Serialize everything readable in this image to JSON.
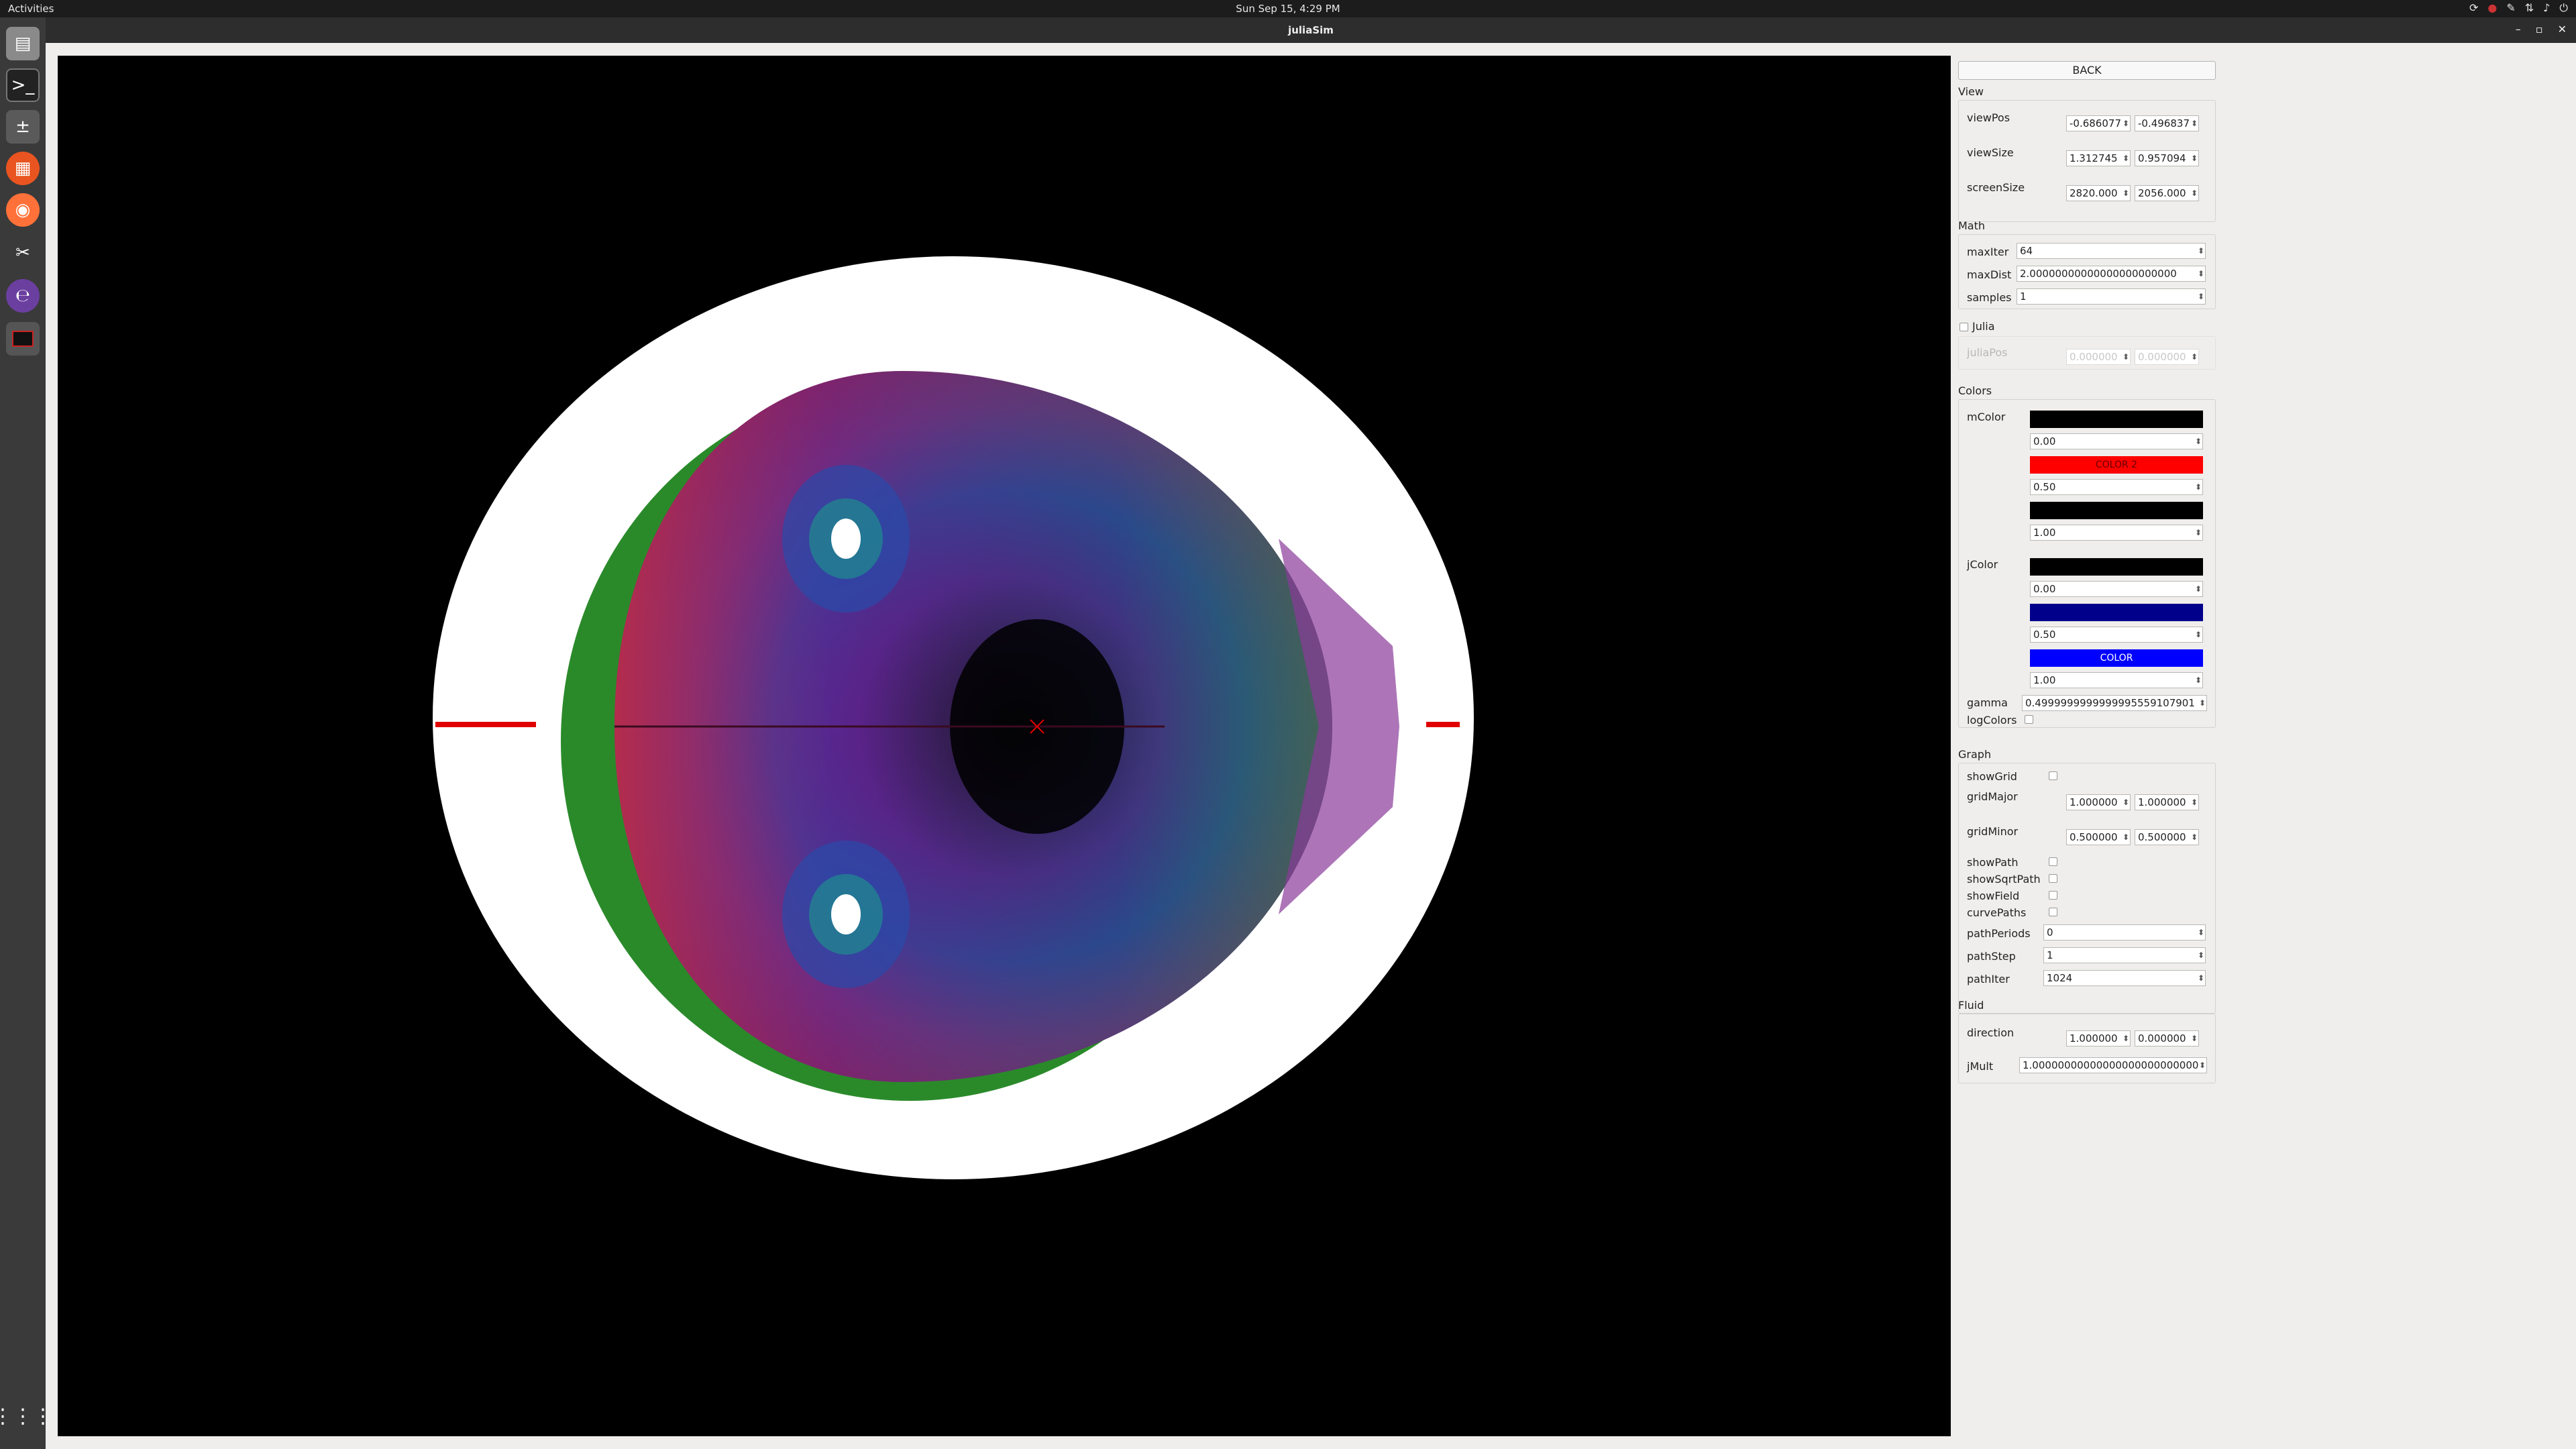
{
  "topbar": {
    "activities": "Activities",
    "clock": "Sun Sep 15,  4:29 PM"
  },
  "window": {
    "title": "juliaSim"
  },
  "panel": {
    "back_label": "BACK",
    "view": {
      "section": "View",
      "viewPos": {
        "label": "viewPos",
        "x": "-0.686077",
        "y": "-0.496837"
      },
      "viewSize": {
        "label": "viewSize",
        "x": "1.312745",
        "y": "0.957094"
      },
      "screenSize": {
        "label": "screenSize",
        "x": "2820.000",
        "y": "2056.000"
      }
    },
    "math": {
      "section": "Math",
      "maxIter": {
        "label": "maxIter",
        "value": "64"
      },
      "maxDist": {
        "label": "maxDist",
        "value": "2.00000000000000000000000"
      },
      "samples": {
        "label": "samples",
        "value": "1"
      }
    },
    "julia": {
      "label": "Julia",
      "juliaPos": {
        "label": "juliaPos",
        "x": "0.000000",
        "y": "0.000000"
      }
    },
    "colors": {
      "section": "Colors",
      "mColor": {
        "label": "mColor",
        "stops": [
          {
            "color": "#000000",
            "text": "",
            "pos": "0.00"
          },
          {
            "color": "#ff0000",
            "text": "COLOR 2",
            "pos": "0.50"
          },
          {
            "color": "#000000",
            "text": "",
            "pos": "1.00"
          }
        ]
      },
      "jColor": {
        "label": "jColor",
        "stops": [
          {
            "color": "#000000",
            "text": "",
            "pos": "0.00"
          },
          {
            "color": "#00008b",
            "text": "",
            "pos": "0.50"
          },
          {
            "color": "#0000ff",
            "text": "COLOR",
            "pos": "1.00"
          }
        ]
      },
      "gamma": {
        "label": "gamma",
        "value": "0.4999999999999995559107901"
      },
      "logColors": {
        "label": "logColors"
      }
    },
    "graph": {
      "section": "Graph",
      "showGrid": {
        "label": "showGrid"
      },
      "gridMajor": {
        "label": "gridMajor",
        "x": "1.000000",
        "y": "1.000000"
      },
      "gridMinor": {
        "label": "gridMinor",
        "x": "0.500000",
        "y": "0.500000"
      },
      "showPath": {
        "label": "showPath"
      },
      "showSqrtPath": {
        "label": "showSqrtPath"
      },
      "showField": {
        "label": "showField"
      },
      "curvePaths": {
        "label": "curvePaths"
      },
      "pathPeriods": {
        "label": "pathPeriods",
        "value": "0"
      },
      "pathStep": {
        "label": "pathStep",
        "value": "1"
      },
      "pathIter": {
        "label": "pathIter",
        "value": "1024"
      }
    },
    "fluid": {
      "section": "Fluid",
      "direction": {
        "label": "direction",
        "x": "1.000000",
        "y": "0.000000"
      },
      "jMult": {
        "label": "jMult",
        "value": "1.00000000000000000000000000"
      }
    }
  }
}
